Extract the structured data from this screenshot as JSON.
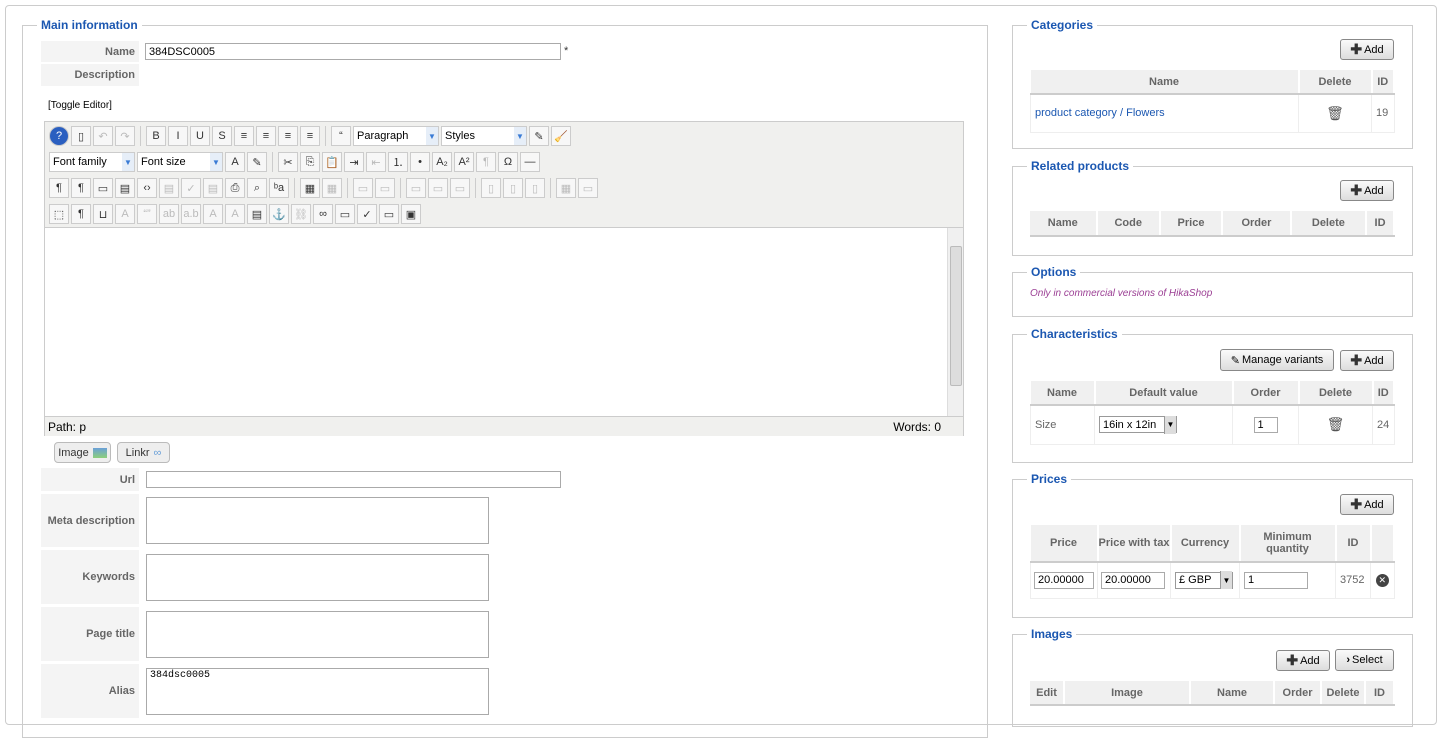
{
  "main": {
    "legend": "Main information",
    "name_label": "Name",
    "name_value": "384DSC0005",
    "required": "*",
    "description_label": "Description",
    "toggle_editor": "[Toggle Editor]",
    "toolbar": {
      "row1": [
        {
          "name": "help",
          "g": "?"
        },
        {
          "name": "new-document",
          "g": "▯"
        },
        {
          "name": "undo",
          "g": "↶",
          "dis": true
        },
        {
          "name": "redo",
          "g": "↷",
          "dis": true
        },
        {
          "sep": true
        },
        {
          "name": "bold",
          "g": "B"
        },
        {
          "name": "italic",
          "g": "I"
        },
        {
          "name": "underline",
          "g": "U"
        },
        {
          "name": "strikethrough",
          "g": "S"
        },
        {
          "name": "align-justify",
          "g": "≡"
        },
        {
          "name": "align-center",
          "g": "≡"
        },
        {
          "name": "align-left",
          "g": "≡"
        },
        {
          "name": "align-right",
          "g": "≡"
        },
        {
          "sep": true
        },
        {
          "name": "blockquote",
          "g": "“"
        }
      ],
      "row1_after": [
        {
          "name": "eraser",
          "g": "✎"
        },
        {
          "name": "cleanup",
          "g": "🧹"
        }
      ],
      "format": "Paragraph",
      "styles": "Styles",
      "font_family": "Font family",
      "font_size": "Font size",
      "row2": [
        {
          "name": "text-color",
          "g": "A"
        },
        {
          "name": "highlight-color",
          "g": "✎"
        },
        {
          "sep": true
        },
        {
          "name": "cut",
          "g": "✂"
        },
        {
          "name": "copy",
          "g": "⎘"
        },
        {
          "name": "paste",
          "g": "📋"
        },
        {
          "name": "indent",
          "g": "⇥"
        },
        {
          "name": "outdent",
          "g": "⇤",
          "dis": true
        },
        {
          "name": "ordered-list",
          "g": "⒈"
        },
        {
          "name": "unordered-list",
          "g": "•"
        },
        {
          "name": "subscript",
          "g": "A₂"
        },
        {
          "name": "superscript",
          "g": "A²"
        },
        {
          "name": "style-props",
          "g": "¶",
          "dis": true
        },
        {
          "name": "special-char",
          "g": "Ω"
        },
        {
          "name": "horizontal-rule",
          "g": "—"
        }
      ],
      "row3": [
        {
          "name": "ltr",
          "g": "¶"
        },
        {
          "name": "rtl",
          "g": "¶"
        },
        {
          "name": "fullscreen",
          "g": "▭"
        },
        {
          "name": "preview",
          "g": "▤"
        },
        {
          "name": "code",
          "g": "‹›"
        },
        {
          "name": "template",
          "g": "▤",
          "dis": true
        },
        {
          "name": "spellcheck-doc",
          "g": "✓",
          "dis": true
        },
        {
          "name": "paste-word",
          "g": "▤",
          "dis": true
        },
        {
          "name": "print",
          "g": "⎙"
        },
        {
          "name": "find",
          "g": "⌕"
        },
        {
          "name": "replace",
          "g": "ᵇa"
        },
        {
          "sep": true
        },
        {
          "name": "table",
          "g": "▦"
        },
        {
          "name": "delete-table",
          "g": "▦",
          "dis": true
        },
        {
          "sep": true
        },
        {
          "name": "row-props",
          "g": "▭",
          "dis": true
        },
        {
          "name": "cell-props",
          "g": "▭",
          "dis": true
        },
        {
          "sep": true
        },
        {
          "name": "insert-row-before",
          "g": "▭",
          "dis": true
        },
        {
          "name": "insert-row-after",
          "g": "▭",
          "dis": true
        },
        {
          "name": "delete-row",
          "g": "▭",
          "dis": true
        },
        {
          "sep": true
        },
        {
          "name": "insert-col-before",
          "g": "▯",
          "dis": true
        },
        {
          "name": "insert-col-after",
          "g": "▯",
          "dis": true
        },
        {
          "name": "delete-col",
          "g": "▯",
          "dis": true
        },
        {
          "sep": true
        },
        {
          "name": "split-cells",
          "g": "▦",
          "dis": true
        },
        {
          "name": "merge-cells",
          "g": "▭",
          "dis": true
        }
      ],
      "row4": [
        {
          "name": "visual-aid",
          "g": "⬚"
        },
        {
          "name": "show-blocks",
          "g": "¶"
        },
        {
          "name": "pagebreak",
          "g": "⊔"
        },
        {
          "name": "styles-attr",
          "g": "A",
          "dis": true
        },
        {
          "name": "cite",
          "g": "“”",
          "dis": true
        },
        {
          "name": "abbr",
          "g": "ab",
          "dis": true
        },
        {
          "name": "acronym",
          "g": "a.b",
          "dis": true
        },
        {
          "name": "del",
          "g": "A",
          "dis": true
        },
        {
          "name": "ins",
          "g": "A",
          "dis": true
        },
        {
          "name": "attributes",
          "g": "▤"
        },
        {
          "name": "anchor",
          "g": "⚓"
        },
        {
          "name": "unlink",
          "g": "⛓",
          "dis": true
        },
        {
          "name": "link",
          "g": "∞"
        },
        {
          "name": "insert-image",
          "g": "▭"
        },
        {
          "name": "spellchecker",
          "g": "✓"
        },
        {
          "name": "layer",
          "g": "▭"
        },
        {
          "name": "media",
          "g": "▣"
        }
      ],
      "path": "Path:  p",
      "words": "Words: 0"
    },
    "image_button": "Image",
    "linkr_button": "Linkr",
    "url_label": "Url",
    "meta_label": "Meta description",
    "keywords_label": "Keywords",
    "page_title_label": "Page title",
    "alias_label": "Alias",
    "alias_value": "384dsc0005"
  },
  "categories": {
    "legend": "Categories",
    "add": "Add",
    "headers": [
      "Name",
      "Delete",
      "ID"
    ],
    "rows": [
      {
        "name": "product category / Flowers",
        "id": "19"
      }
    ]
  },
  "related": {
    "legend": "Related products",
    "add": "Add",
    "headers": [
      "Name",
      "Code",
      "Price",
      "Order",
      "Delete",
      "ID"
    ]
  },
  "options": {
    "legend": "Options",
    "note": "Only in commercial versions of HikaShop"
  },
  "characteristics": {
    "legend": "Characteristics",
    "manage": "Manage variants",
    "add": "Add",
    "headers": [
      "Name",
      "Default value",
      "Order",
      "Delete",
      "ID"
    ],
    "rows": [
      {
        "name": "Size",
        "default": "16in x 12in",
        "order": "1",
        "id": "24"
      }
    ]
  },
  "prices": {
    "legend": "Prices",
    "add": "Add",
    "headers": [
      "Price",
      "Price with tax",
      "Currency",
      "Minimum quantity",
      "ID"
    ],
    "rows": [
      {
        "price": "20.00000",
        "price_tax": "20.00000",
        "currency": "£ GBP",
        "min_qty": "1",
        "id": "3752"
      }
    ]
  },
  "images": {
    "legend": "Images",
    "add": "Add",
    "select": "Select",
    "headers": [
      "Edit",
      "Image",
      "Name",
      "Order",
      "Delete",
      "ID"
    ]
  }
}
